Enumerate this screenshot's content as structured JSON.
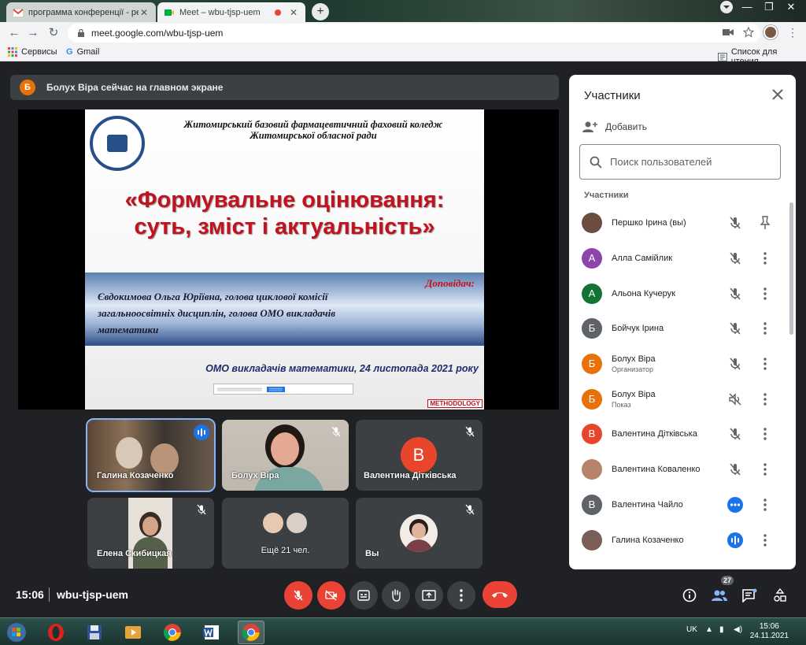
{
  "browser": {
    "tabs": [
      {
        "title": "программа конференції - pershi",
        "icon": "gmail-icon",
        "active": false
      },
      {
        "title": "Meet – wbu-tjsp-uem",
        "icon": "meet-icon",
        "active": true
      }
    ],
    "url": "meet.google.com/wbu-tjsp-uem",
    "bookmarks": [
      {
        "label": "Сервисы",
        "icon": "apps-grid-icon"
      },
      {
        "label": "Gmail",
        "icon": "google-icon"
      }
    ],
    "reading_list": "Список для чтения"
  },
  "banner": {
    "avatar_letter": "Б",
    "text": "Болух Віра сейчас на главном экране"
  },
  "slide": {
    "college_line1": "Житомирський базовий фармацевтичний фаховий коледж",
    "college_line2": "Житомирської обласної ради",
    "title_line1": "«Формувальне оцінювання:",
    "title_line2": "суть, зміст і актуальність»",
    "speaker_label": "Доповідач:",
    "speaker": "Євдокимова Ольга Юріївна, голова циклової комісії загальноосвітніх дисциплін, голова ОМО викладачів математики",
    "event": "ОМО викладачів математики, 24 листопада 2021 року",
    "brand": "METHODOLOGY"
  },
  "tiles": {
    "t1": "Галина Козаченко",
    "t2": "Болух Віра",
    "t3": {
      "name": "Валентина Дітківська",
      "letter": "В"
    },
    "t4": "Елена Скибицкая",
    "t5": "Ещё 21 чел.",
    "t6": "Вы"
  },
  "bottom": {
    "time": "15:06",
    "meeting_code": "wbu-tjsp-uem",
    "participant_count": "27"
  },
  "panel": {
    "title": "Участники",
    "add_label": "Добавить",
    "search_placeholder": "Поиск пользователей",
    "section": "Участники",
    "participants": [
      {
        "name": "Першко Ірина (вы)",
        "sub": "",
        "letter": "",
        "color": "#6d4c41",
        "state": "mic-off"
      },
      {
        "name": "Алла Самійлик",
        "sub": "",
        "letter": "А",
        "color": "#8e44ad",
        "state": "mic-off"
      },
      {
        "name": "Альона Кучерук",
        "sub": "",
        "letter": "А",
        "color": "#137333",
        "state": "mic-off"
      },
      {
        "name": "Бойчук Ірина",
        "sub": "",
        "letter": "Б",
        "color": "#5f6368",
        "state": "mic-off"
      },
      {
        "name": "Болух Віра",
        "sub": "Организатор",
        "letter": "Б",
        "color": "#e8710a",
        "state": "mic-off"
      },
      {
        "name": "Болух Віра",
        "sub": "Показ",
        "letter": "Б",
        "color": "#e8710a",
        "state": "sound-off"
      },
      {
        "name": "Валентина Дітківська",
        "sub": "",
        "letter": "В",
        "color": "#e8452c",
        "state": "mic-off"
      },
      {
        "name": "Валентина Коваленко",
        "sub": "",
        "letter": "",
        "color": "#b7846b",
        "state": "mic-off"
      },
      {
        "name": "Валентина Чайло",
        "sub": "",
        "letter": "В",
        "color": "#5f6368",
        "state": "dots"
      },
      {
        "name": "Галина Козаченко",
        "sub": "",
        "letter": "",
        "color": "#7b5e57",
        "state": "speaking"
      }
    ]
  },
  "taskbar": {
    "lang": "UK",
    "time": "15:06",
    "date": "24.11.2021"
  }
}
